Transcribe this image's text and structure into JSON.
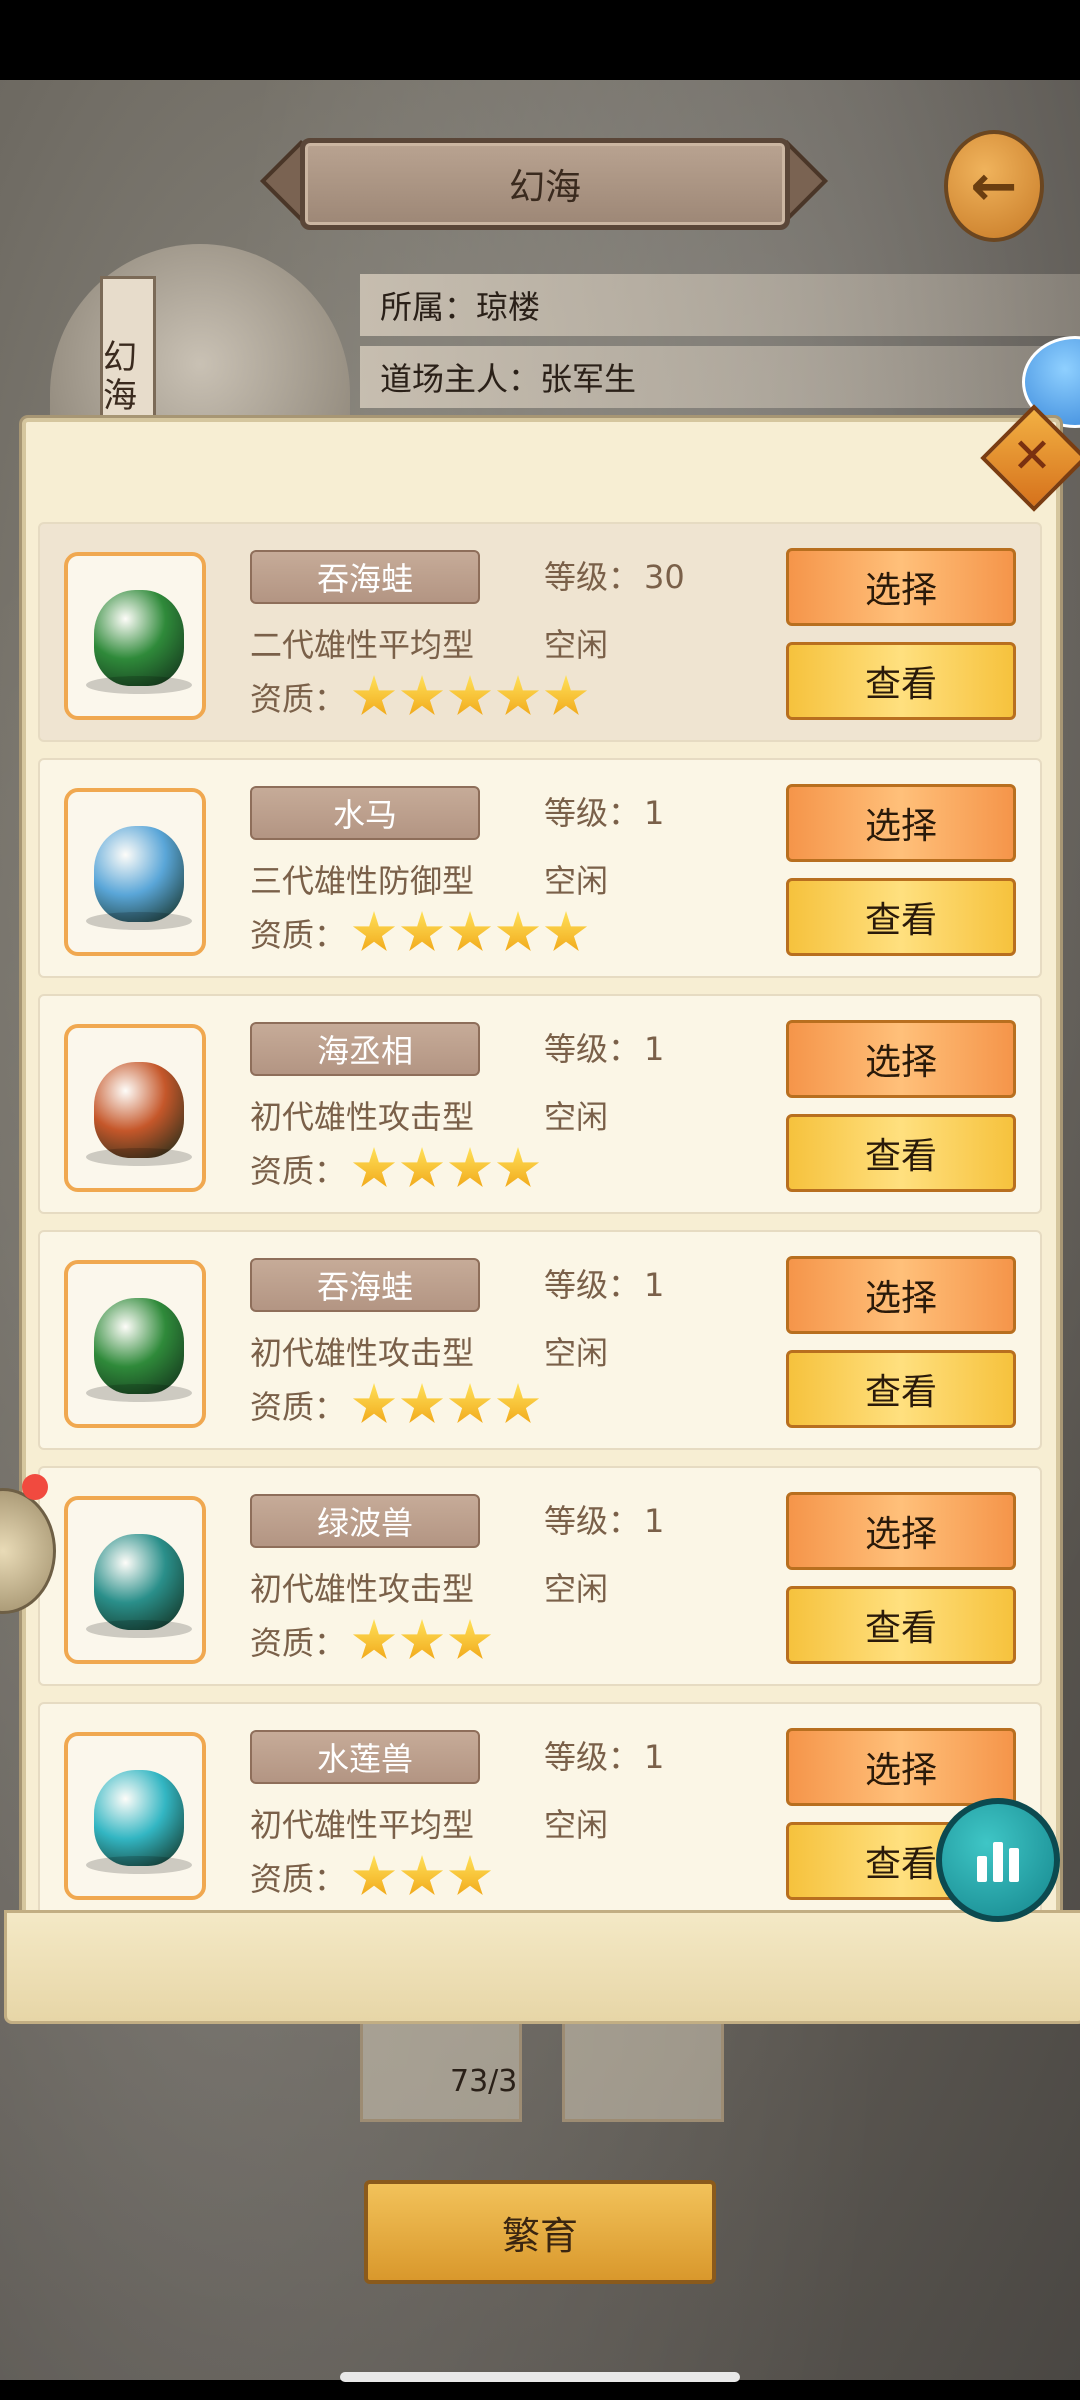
{
  "title": "幻海",
  "info": {
    "affiliation": "所属：琼楼",
    "owner": "道场主人：张军生",
    "banner_text": "幻海"
  },
  "labels": {
    "level_prefix": "等级：",
    "quality_prefix": "资质：",
    "select": "选择",
    "view": "查看"
  },
  "pets": [
    {
      "name": "吞海蛙",
      "level": "30",
      "desc": "二代雄性平均型",
      "status": "空闲",
      "stars": 5,
      "color": "#2f8a3a",
      "selected": true
    },
    {
      "name": "水马",
      "level": "1",
      "desc": "三代雄性防御型",
      "status": "空闲",
      "stars": 5,
      "color": "#5aa6d8",
      "selected": false
    },
    {
      "name": "海丞相",
      "level": "1",
      "desc": "初代雄性攻击型",
      "status": "空闲",
      "stars": 4,
      "color": "#c5572a",
      "selected": false
    },
    {
      "name": "吞海蛙",
      "level": "1",
      "desc": "初代雄性攻击型",
      "status": "空闲",
      "stars": 4,
      "color": "#2f8a3a",
      "selected": false
    },
    {
      "name": "绿波兽",
      "level": "1",
      "desc": "初代雄性攻击型",
      "status": "空闲",
      "stars": 3,
      "color": "#2a8f8a",
      "selected": false
    },
    {
      "name": "水莲兽",
      "level": "1",
      "desc": "初代雄性平均型",
      "status": "空闲",
      "stars": 3,
      "color": "#33b6c3",
      "selected": false
    }
  ],
  "bottom": {
    "slot_count": "73/3",
    "breed_label": "繁育"
  }
}
